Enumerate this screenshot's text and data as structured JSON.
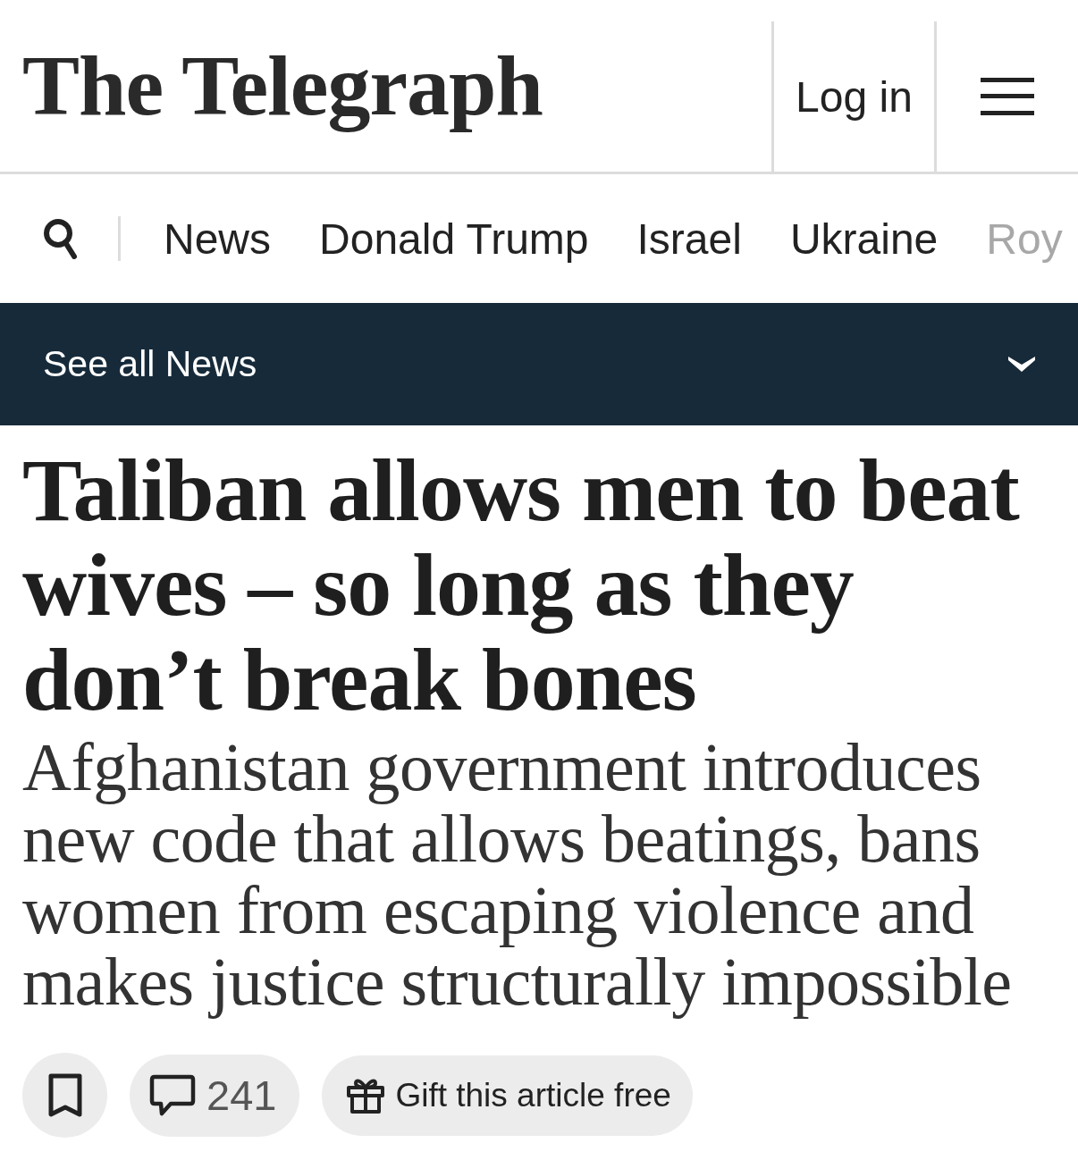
{
  "header": {
    "logo": "The Telegraph",
    "login": "Log in"
  },
  "nav": {
    "items": [
      {
        "label": "News",
        "faded": false
      },
      {
        "label": "Donald Trump",
        "faded": false
      },
      {
        "label": "Israel",
        "faded": false
      },
      {
        "label": "Ukraine",
        "faded": false
      },
      {
        "label": "Roy",
        "faded": true
      }
    ]
  },
  "section_bar": {
    "label": "See all News",
    "expanded": false
  },
  "article": {
    "headline": "Taliban allows men to beat wives – so long as they don’t break bones",
    "standfirst": "Afghanistan government introduces new code that allows beatings, bans women from escaping violence and makes justice structurally impossible"
  },
  "actions": {
    "comments": "241",
    "gift": "Gift this article free"
  }
}
